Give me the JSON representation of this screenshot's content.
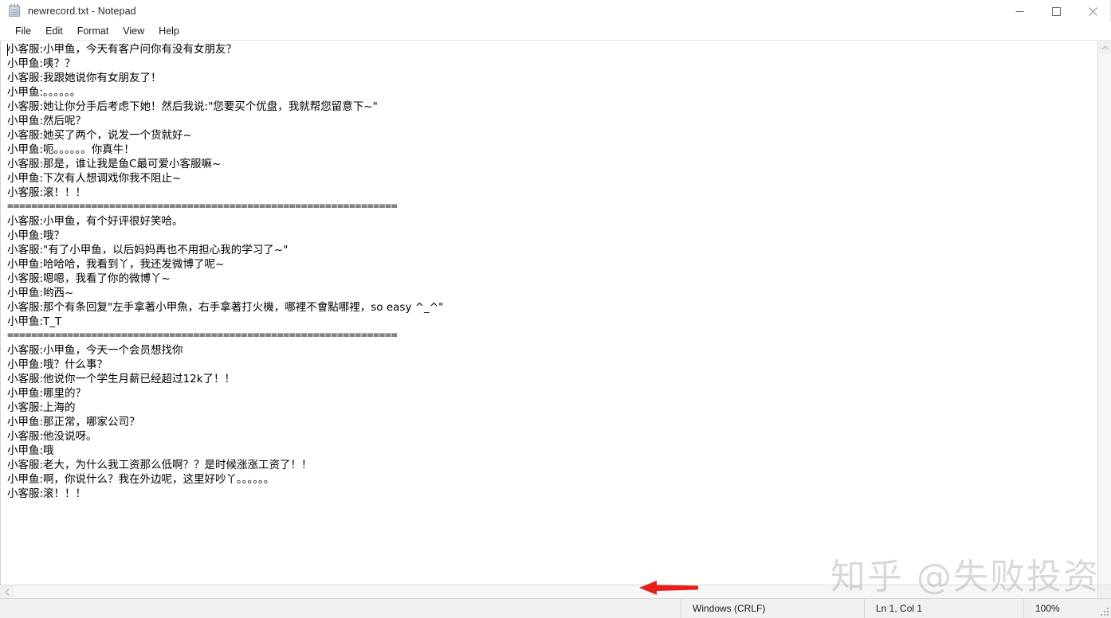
{
  "window": {
    "title": "newrecord.txt - Notepad",
    "icon": "notepad-icon",
    "controls": {
      "minimize": "minimize-icon",
      "maximize": "maximize-icon",
      "close": "close-icon"
    }
  },
  "menubar": {
    "items": [
      {
        "label": "File"
      },
      {
        "label": "Edit"
      },
      {
        "label": "Format"
      },
      {
        "label": "View"
      },
      {
        "label": "Help"
      }
    ]
  },
  "document": {
    "lines": [
      "小客服:小甲鱼，今天有客户问你有没有女朋友？",
      "小甲鱼:咦？？",
      "小客服:我跟她说你有女朋友了！",
      "小甲鱼:。。。。。。",
      "小客服:她让你分手后考虑下她！然后我说:\"您要买个优盘，我就帮您留意下~\"",
      "小甲鱼:然后呢？",
      "小客服:她买了两个，说发一个货就好~",
      "小甲鱼:呃。。。。。。你真牛！",
      "小客服:那是，谁让我是鱼C最可爱小客服嘛~",
      "小甲鱼:下次有人想调戏你我不阻止~",
      "小客服:滚！！！",
      "=================================================================",
      "小客服:小甲鱼，有个好评很好笑哈。",
      "小甲鱼:哦？",
      "小客服:\"有了小甲鱼，以后妈妈再也不用担心我的学习了~\"",
      "小甲鱼:哈哈哈，我看到丫，我还发微博了呢~",
      "小客服:嗯嗯，我看了你的微博丫~",
      "小甲鱼:哟西~",
      "小客服:那个有条回复\"左手拿著小甲魚，右手拿著打火機，哪裡不會點哪裡，so easy ^_^\"",
      "小甲鱼:T_T",
      "=================================================================",
      "小客服:小甲鱼，今天一个会员想找你",
      "小甲鱼:哦？什么事？",
      "小客服:他说你一个学生月薪已经超过12k了！！",
      "小甲鱼:哪里的？",
      "小客服:上海的",
      "小甲鱼:那正常，哪家公司？",
      "小客服:他没说呀。",
      "小甲鱼:哦",
      "小客服:老大，为什么我工资那么低啊？？是时候涨涨工资了！！",
      "小甲鱼:啊，你说什么？我在外边呢，这里好吵丫。。。。。。",
      "小客服:滚！！！"
    ]
  },
  "scrollbars": {
    "vertical_up": "chevron-up-icon",
    "vertical_down": "chevron-down-icon",
    "horizontal_left": "chevron-left-icon",
    "horizontal_right": "chevron-right-icon"
  },
  "statusbar": {
    "line_ending": "Windows (CRLF)",
    "cursor_position": "Ln 1, Col 1",
    "zoom": "100%"
  },
  "annotation": {
    "arrow_color": "#e8201c",
    "arrow_direction": "left"
  },
  "watermark": {
    "text": "知乎 @失败投资"
  }
}
